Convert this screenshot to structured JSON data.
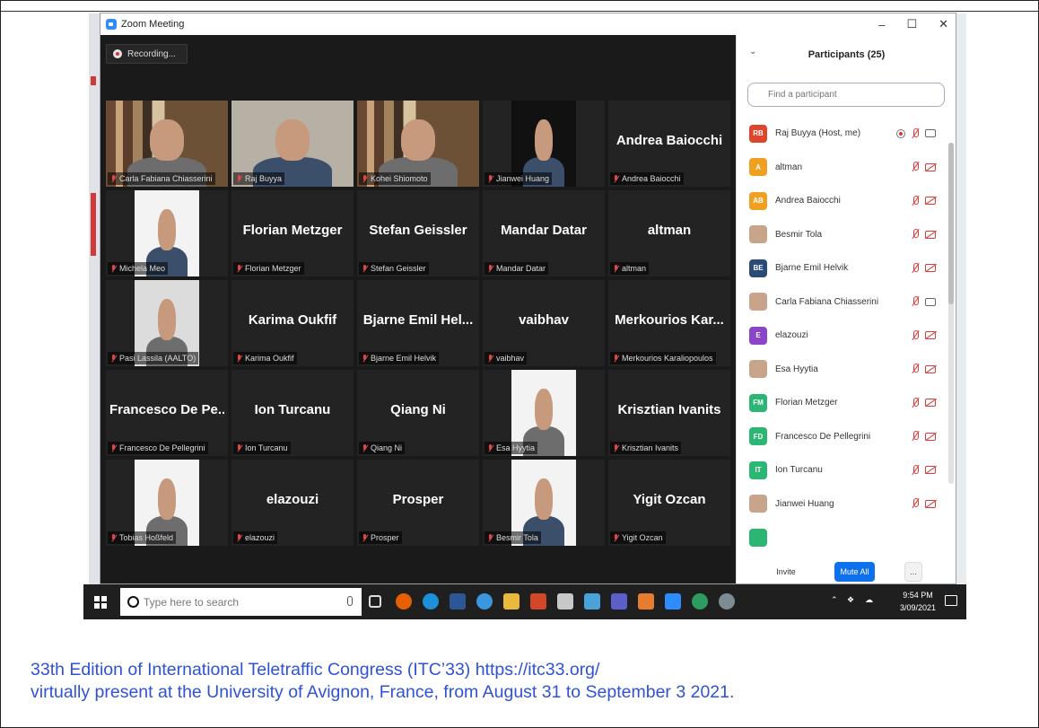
{
  "window": {
    "title": "Zoom Meeting",
    "controls": [
      "–",
      "☐",
      "✕"
    ]
  },
  "meeting": {
    "recording_label": "Recording..."
  },
  "tiles": [
    {
      "label": "Carla Fabiana Chiasserini",
      "big": "",
      "video": "shelf"
    },
    {
      "label": "Raj Buyya",
      "big": "",
      "video": "wall",
      "active": true
    },
    {
      "label": "Kohei Shiomoto",
      "big": "",
      "video": "shelf"
    },
    {
      "label": "Jianwei Huang",
      "big": "",
      "video": "dark"
    },
    {
      "label": "Andrea Baiocchi",
      "big": "Andrea Baiocchi"
    },
    {
      "label": "Michela Meo",
      "big": "",
      "video": "white"
    },
    {
      "label": "Florian Metzger",
      "big": "Florian Metzger"
    },
    {
      "label": "Stefan Geissler",
      "big": "Stefan Geissler"
    },
    {
      "label": "Mandar Datar",
      "big": "Mandar Datar"
    },
    {
      "label": "altman",
      "big": "altman"
    },
    {
      "label": "Pasi Lassila (AALTO)",
      "big": "",
      "video": "light"
    },
    {
      "label": "Karima Oukfif",
      "big": "Karima Oukfif"
    },
    {
      "label": "Bjarne Emil Helvik",
      "big": "Bjarne Emil Hel..."
    },
    {
      "label": "vaibhav",
      "big": "vaibhav"
    },
    {
      "label": "Merkourios Karaliopoulos",
      "big": "Merkourios Kar..."
    },
    {
      "label": "Francesco De Pellegrini",
      "big": "Francesco De Pe..."
    },
    {
      "label": "Ion Turcanu",
      "big": "Ion Turcanu"
    },
    {
      "label": "Qiang Ni",
      "big": "Qiang Ni"
    },
    {
      "label": "Esa Hyytia",
      "big": "",
      "video": "white"
    },
    {
      "label": "Krisztian Ivanits",
      "big": "Krisztian Ivanits"
    },
    {
      "label": "Tobias Hoßfeld",
      "big": "",
      "video": "white"
    },
    {
      "label": "elazouzi",
      "big": "elazouzi"
    },
    {
      "label": "Prosper",
      "big": "Prosper"
    },
    {
      "label": "Besmir Tola",
      "big": "",
      "video": "white"
    },
    {
      "label": "Yigit Ozcan",
      "big": "Yigit Ozcan"
    }
  ],
  "panel": {
    "title": "Participants (25)",
    "search_placeholder": "Find a participant",
    "participants": [
      {
        "initials": "RB",
        "color": "#e0452b",
        "name": "Raj Buyya (Host, me)",
        "rec": true,
        "cam_on": true
      },
      {
        "initials": "A",
        "color": "#f0a020",
        "name": "altman"
      },
      {
        "initials": "AB",
        "color": "#f0a020",
        "name": "Andrea Baiocchi"
      },
      {
        "initials": "",
        "color": "",
        "name": "Besmir Tola",
        "photo": true
      },
      {
        "initials": "BE",
        "color": "#2a4a7a",
        "name": "Bjarne Emil Helvik"
      },
      {
        "initials": "",
        "color": "",
        "name": "Carla Fabiana Chiasserini",
        "photo": true,
        "cam_on": true
      },
      {
        "initials": "E",
        "color": "#8b45c9",
        "name": "elazouzi"
      },
      {
        "initials": "",
        "color": "",
        "name": "Esa Hyytia",
        "photo": true
      },
      {
        "initials": "FM",
        "color": "#2bb673",
        "name": "Florian Metzger"
      },
      {
        "initials": "FD",
        "color": "#2bb673",
        "name": "Francesco De Pellegrini"
      },
      {
        "initials": "IT",
        "color": "#2bb673",
        "name": "Ion Turcanu"
      },
      {
        "initials": "",
        "color": "",
        "name": "Jianwei Huang",
        "photo": true
      },
      {
        "initials": "",
        "color": "#2bb673",
        "name": ""
      }
    ],
    "invite_label": "Invite",
    "mute_all_label": "Mute All",
    "more_label": "..."
  },
  "taskbar": {
    "search_placeholder": "Type here to search",
    "time": "9:54 PM",
    "date": "3/09/2021"
  },
  "caption": {
    "line1": "33th Edition of International Teletraffic Congress (ITC’33) https://itc33.org/",
    "line2": "virtually present at the University of Avignon, France, from August 31 to September 3 2021."
  }
}
